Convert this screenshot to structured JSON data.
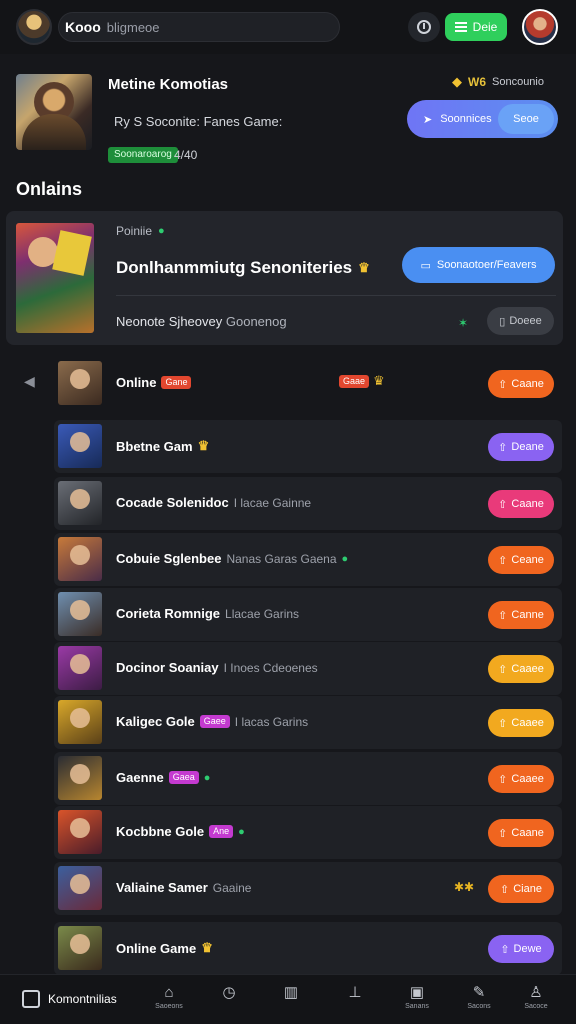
{
  "topbar": {
    "brand": "Kooo",
    "search_placeholder": "bligmeoe",
    "action_label": "Deie"
  },
  "hero": {
    "title": "Metine Komotias",
    "subtitle": "Ry S Soconite: Fanes Game:",
    "badge": "Soonaroarog",
    "count": "4/40",
    "meta_tag": "W6",
    "meta_text": "Soncounio",
    "pill_label": "Soonnices",
    "pill_sub": "Seoe"
  },
  "section_title": "Onlains",
  "featured": {
    "label": "Poiniie",
    "title": "Donlhanmmiutg Senoniteries",
    "cta": "Soonaotoer/Feavers",
    "subtitle_main": "Neonote Sjheovey",
    "subtitle_muted": "Goonenog",
    "grey_button": "Doeee"
  },
  "rows": [
    {
      "title": "Online",
      "tag": "Gane",
      "tag_color": "#e2472f",
      "extra_tag": "Gaae",
      "button": "Caane",
      "btn_color": "#f0651f",
      "boxed": false,
      "thumb": [
        "#8a6b4c",
        "#3b2a20"
      ]
    },
    {
      "title": "Bbetne Gam",
      "button": "Deane",
      "btn_color": "#8a63f2",
      "boxed": true,
      "thumb": [
        "#3a5ab8",
        "#172a57"
      ]
    },
    {
      "title": "Cocade Solenidoc",
      "muted": "I lacae Gainne",
      "button": "Caane",
      "btn_color": "#e93a7a",
      "boxed": true,
      "thumb": [
        "#6a6e76",
        "#222428"
      ]
    },
    {
      "title": "Cobuie Sglenbee",
      "muted": "Nanas Garas Gaena",
      "button": "Ceane",
      "btn_color": "#f0651f",
      "boxed": true,
      "thumb": [
        "#c77a3a",
        "#4a2c48"
      ]
    },
    {
      "title": "Corieta Romnige",
      "muted": "Llacae Garins",
      "button": "Canne",
      "btn_color": "#f0651f",
      "boxed": true,
      "thumb": [
        "#6f8fb0",
        "#3a2c26"
      ]
    },
    {
      "title": "Docinor Soaniay",
      "muted": "I Inoes Cdeoenes",
      "button": "Caaee",
      "btn_color": "#f2a91f",
      "boxed": true,
      "thumb": [
        "#9a3aa6",
        "#3c1c44"
      ]
    },
    {
      "title": "Kaligec Gole",
      "tag": "Gaee",
      "tag_color": "#c43ad0",
      "muted": "I lacas Garins",
      "button": "Caaee",
      "btn_color": "#f2a91f",
      "boxed": true,
      "thumb": [
        "#d9a82a",
        "#5a4018"
      ]
    },
    {
      "title": "Gaenne",
      "tag": "Gaea",
      "tag_color": "#c43ad0",
      "button": "Caaee",
      "btn_color": "#f0651f",
      "boxed": true,
      "thumb": [
        "#2a2c33",
        "#b8862f"
      ]
    },
    {
      "title": "Kocbbne Gole",
      "tag": "Ane",
      "tag_color": "#c43ad0",
      "button": "Caane",
      "btn_color": "#f0651f",
      "boxed": true,
      "thumb": [
        "#d9542a",
        "#4a1c2a"
      ]
    },
    {
      "title": "Valiaine Samer",
      "muted": "Gaaine",
      "side": "✱✱",
      "button": "Ciane",
      "btn_color": "#f0651f",
      "boxed": true,
      "thumb": [
        "#3b5f9e",
        "#6a2a3a"
      ]
    },
    {
      "title": "Online Game",
      "button": "Dewe",
      "btn_color": "#8a63f2",
      "boxed": true,
      "thumb": [
        "#7a8a4a",
        "#3a2a1c"
      ]
    }
  ],
  "bottom_nav": {
    "brand": "Komontnilias",
    "items": [
      {
        "icon": "⌂",
        "label": "Saoeons"
      },
      {
        "icon": "◷",
        "label": ""
      },
      {
        "icon": "▥",
        "label": ""
      },
      {
        "icon": "⊥",
        "label": ""
      },
      {
        "icon": "▣",
        "label": "Sanans"
      },
      {
        "icon": "✎",
        "label": "Sacons"
      },
      {
        "icon": "♙",
        "label": "Sacoce"
      }
    ]
  }
}
